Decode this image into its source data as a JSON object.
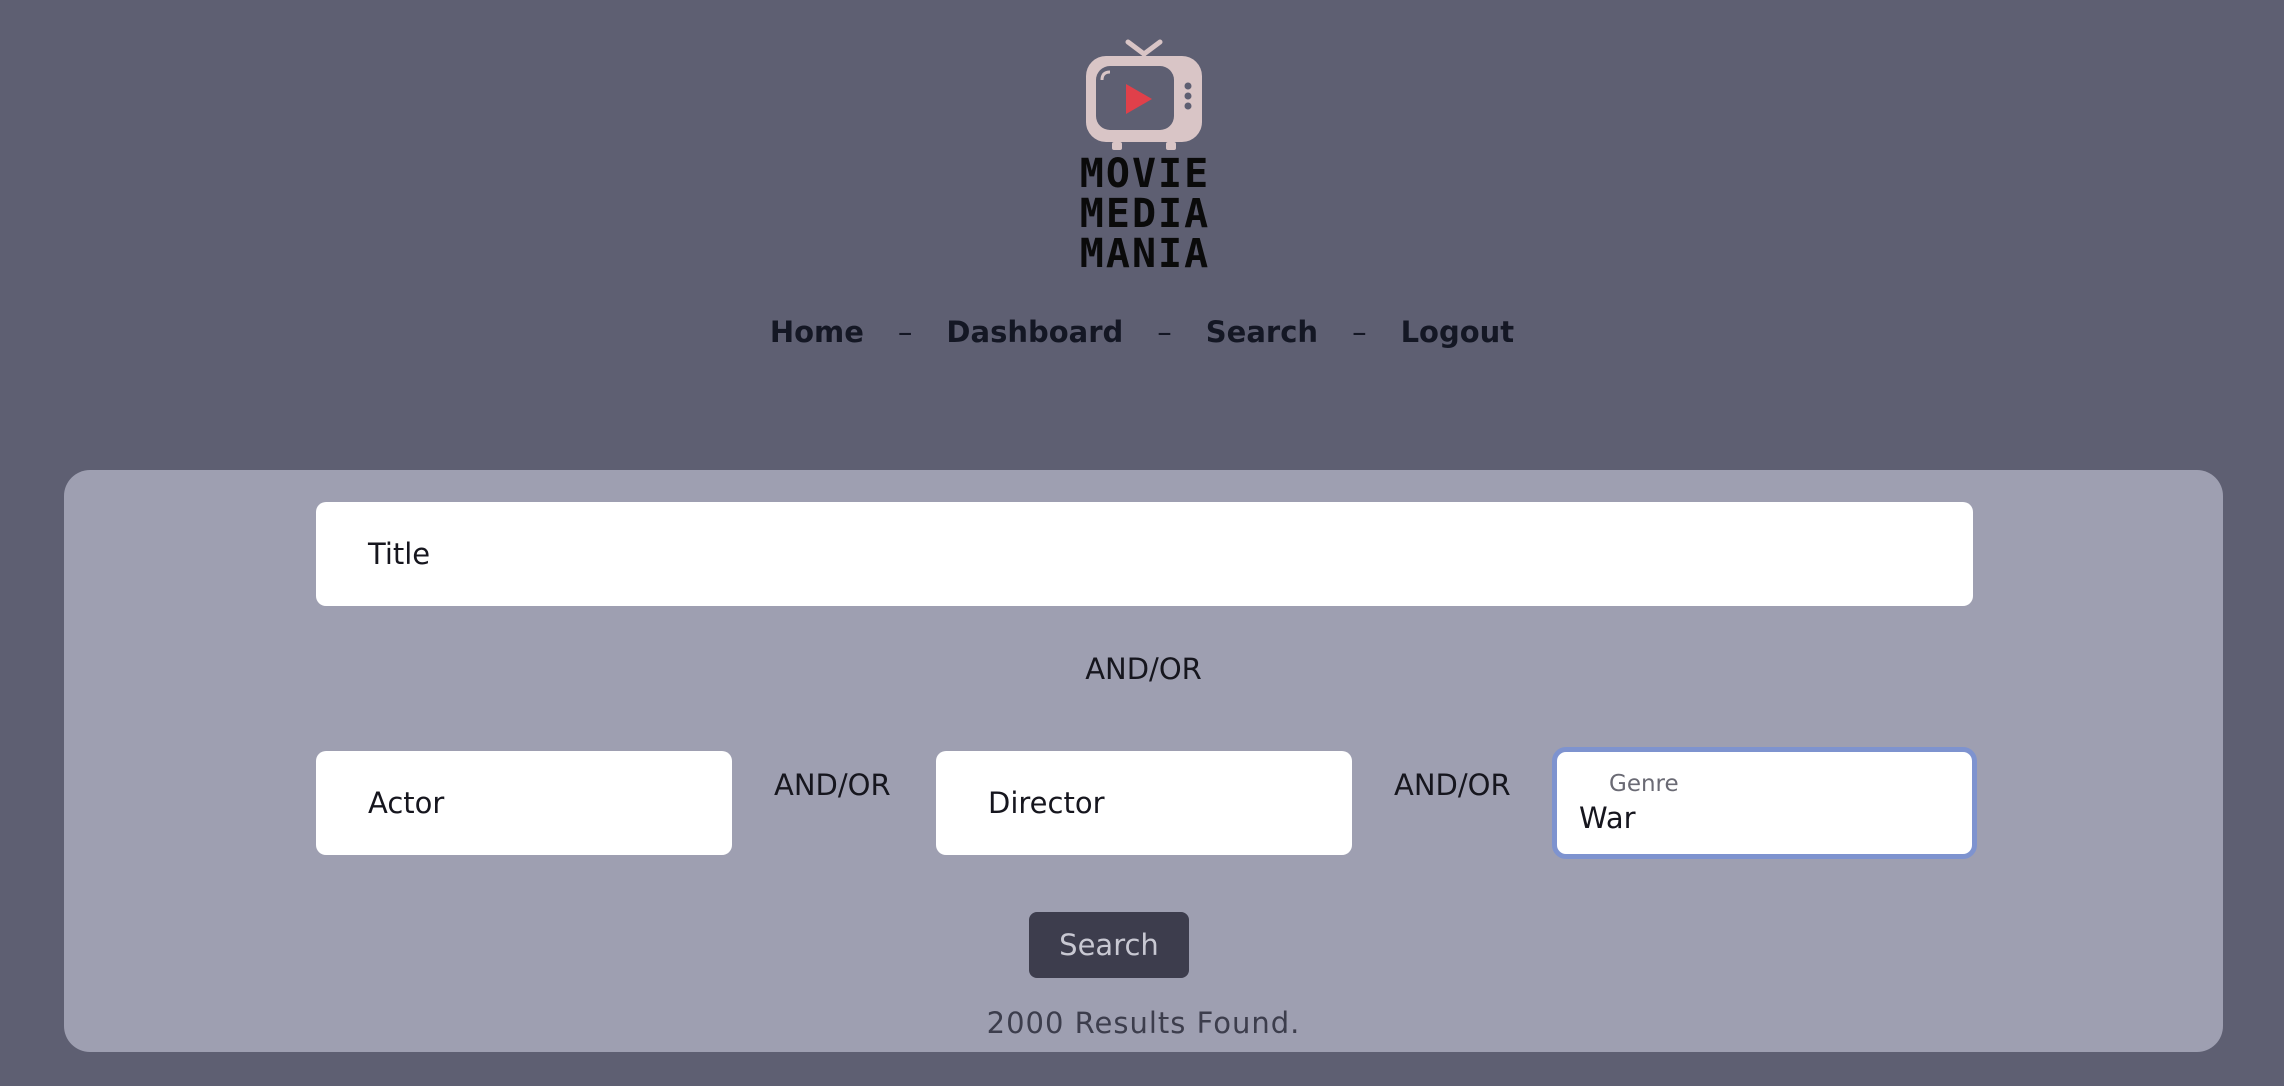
{
  "brand": {
    "logo_lines": [
      "MOVIE",
      "MEDIA",
      "MANIA"
    ],
    "colors": {
      "tv_body": "#d9c5c6",
      "play": "#e0404a"
    }
  },
  "nav": {
    "items": [
      {
        "label": "Home"
      },
      {
        "label": "Dashboard"
      },
      {
        "label": "Search"
      },
      {
        "label": "Logout"
      }
    ],
    "separator": "–"
  },
  "search": {
    "title_placeholder": "Title",
    "actor_placeholder": "Actor",
    "director_placeholder": "Director",
    "genre_label": "Genre",
    "genre_value": "War",
    "connector": "AND/OR",
    "button_label": "Search",
    "results_text": "2000 Results Found."
  },
  "colors": {
    "page_bg": "#5e5f72",
    "panel_bg": "#9e9fb1",
    "focus_border": "#7e93cf",
    "button_bg": "#3d3d4d"
  }
}
